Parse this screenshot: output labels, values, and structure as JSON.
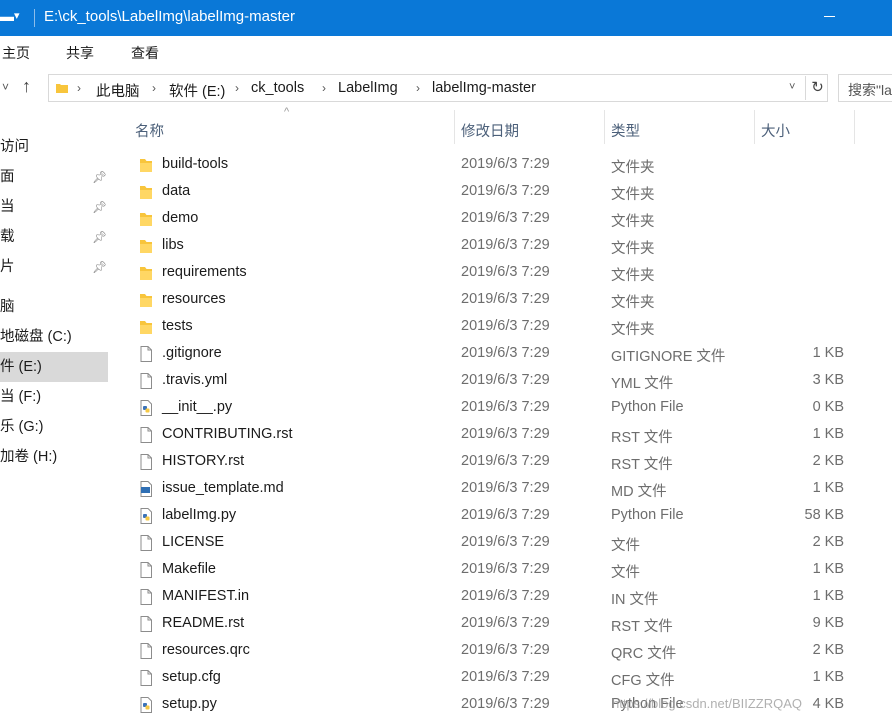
{
  "window": {
    "title": "E:\\ck_tools\\LabelImg\\labelImg-master"
  },
  "ribbon": {
    "tabs": [
      "主页",
      "共享",
      "查看"
    ]
  },
  "address": {
    "crumbs": [
      "此电脑",
      "软件 (E:)",
      "ck_tools",
      "LabelImg",
      "labelImg-master"
    ],
    "search_placeholder": "搜索\"la"
  },
  "navpane": {
    "items": [
      {
        "label": "访问",
        "pinned": false
      },
      {
        "label": "面",
        "pinned": true
      },
      {
        "label": "当",
        "pinned": true
      },
      {
        "label": "载",
        "pinned": true
      },
      {
        "label": "片",
        "pinned": true
      },
      {
        "label": "脑",
        "pinned": false
      },
      {
        "label": "地磁盘 (C:)",
        "pinned": false
      },
      {
        "label": "件 (E:)",
        "pinned": false,
        "selected": true
      },
      {
        "label": "当 (F:)",
        "pinned": false
      },
      {
        "label": "乐 (G:)",
        "pinned": false
      },
      {
        "label": "加卷 (H:)",
        "pinned": false
      }
    ]
  },
  "columns": {
    "name": "名称",
    "date": "修改日期",
    "type": "类型",
    "size": "大小"
  },
  "files": [
    {
      "name": "build-tools",
      "date": "2019/6/3 7:29",
      "type": "文件夹",
      "size": "",
      "icon": "folder-icon"
    },
    {
      "name": "data",
      "date": "2019/6/3 7:29",
      "type": "文件夹",
      "size": "",
      "icon": "folder-icon"
    },
    {
      "name": "demo",
      "date": "2019/6/3 7:29",
      "type": "文件夹",
      "size": "",
      "icon": "folder-icon"
    },
    {
      "name": "libs",
      "date": "2019/6/3 7:29",
      "type": "文件夹",
      "size": "",
      "icon": "folder-icon"
    },
    {
      "name": "requirements",
      "date": "2019/6/3 7:29",
      "type": "文件夹",
      "size": "",
      "icon": "folder-icon"
    },
    {
      "name": "resources",
      "date": "2019/6/3 7:29",
      "type": "文件夹",
      "size": "",
      "icon": "folder-icon"
    },
    {
      "name": "tests",
      "date": "2019/6/3 7:29",
      "type": "文件夹",
      "size": "",
      "icon": "folder-icon"
    },
    {
      "name": ".gitignore",
      "date": "2019/6/3 7:29",
      "type": "GITIGNORE 文件",
      "size": "1 KB",
      "icon": "file-icon"
    },
    {
      "name": ".travis.yml",
      "date": "2019/6/3 7:29",
      "type": "YML 文件",
      "size": "3 KB",
      "icon": "file-icon"
    },
    {
      "name": "__init__.py",
      "date": "2019/6/3 7:29",
      "type": "Python File",
      "size": "0 KB",
      "icon": "python-file-icon"
    },
    {
      "name": "CONTRIBUTING.rst",
      "date": "2019/6/3 7:29",
      "type": "RST 文件",
      "size": "1 KB",
      "icon": "file-icon"
    },
    {
      "name": "HISTORY.rst",
      "date": "2019/6/3 7:29",
      "type": "RST 文件",
      "size": "2 KB",
      "icon": "file-icon"
    },
    {
      "name": "issue_template.md",
      "date": "2019/6/3 7:29",
      "type": "MD 文件",
      "size": "1 KB",
      "icon": "markdown-file-icon"
    },
    {
      "name": "labelImg.py",
      "date": "2019/6/3 7:29",
      "type": "Python File",
      "size": "58 KB",
      "icon": "python-file-icon"
    },
    {
      "name": "LICENSE",
      "date": "2019/6/3 7:29",
      "type": "文件",
      "size": "2 KB",
      "icon": "file-icon"
    },
    {
      "name": "Makefile",
      "date": "2019/6/3 7:29",
      "type": "文件",
      "size": "1 KB",
      "icon": "file-icon"
    },
    {
      "name": "MANIFEST.in",
      "date": "2019/6/3 7:29",
      "type": "IN 文件",
      "size": "1 KB",
      "icon": "file-icon"
    },
    {
      "name": "README.rst",
      "date": "2019/6/3 7:29",
      "type": "RST 文件",
      "size": "9 KB",
      "icon": "file-icon"
    },
    {
      "name": "resources.qrc",
      "date": "2019/6/3 7:29",
      "type": "QRC 文件",
      "size": "2 KB",
      "icon": "file-icon"
    },
    {
      "name": "setup.cfg",
      "date": "2019/6/3 7:29",
      "type": "CFG 文件",
      "size": "1 KB",
      "icon": "file-icon"
    },
    {
      "name": "setup.py",
      "date": "2019/6/3 7:29",
      "type": "Python File",
      "size": "4 KB",
      "icon": "python-file-icon"
    }
  ],
  "watermark": "https://blog.csdn.net/BIIZZRQAQ",
  "colors": {
    "titlebar": "#0a78d7",
    "folder": "#f8c53c",
    "selected_nav": "#d9d9d9",
    "header_text": "#4c607a"
  }
}
